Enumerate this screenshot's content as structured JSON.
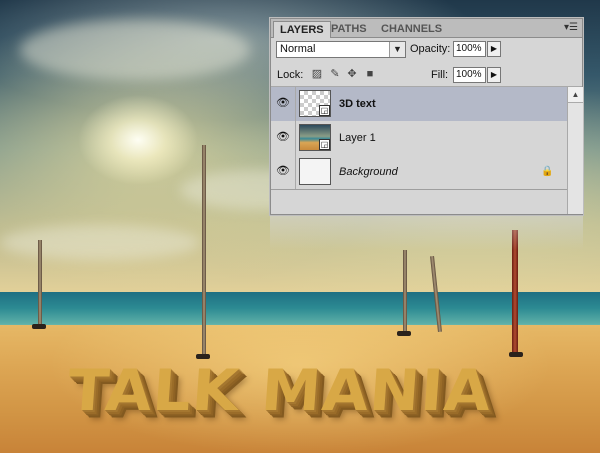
{
  "scene": {
    "headline": "TALK MANIA"
  },
  "panel": {
    "tabs": [
      {
        "label": "LAYERS",
        "active": true
      },
      {
        "label": "PATHS",
        "active": false
      },
      {
        "label": "CHANNELS",
        "active": false
      }
    ],
    "menu_icon": "panel-menu-icon",
    "blend_mode": "Normal",
    "opacity_label": "Opacity:",
    "opacity_value": "100%",
    "lock_label": "Lock:",
    "fill_label": "Fill:",
    "fill_value": "100%",
    "lock_icons": [
      "lock-transparent-icon",
      "lock-brush-icon",
      "lock-move-icon",
      "lock-all-icon"
    ],
    "layers": [
      {
        "name": "3D text",
        "selected": true,
        "thumb": "transparent",
        "smart_object": true,
        "style": "bold"
      },
      {
        "name": "Layer 1",
        "selected": false,
        "thumb": "photo",
        "smart_object": true,
        "style": "normal"
      },
      {
        "name": "Background",
        "selected": false,
        "thumb": "white",
        "smart_object": false,
        "style": "italic",
        "locked": true
      }
    ]
  },
  "colors": {
    "panel_bg": "#d6d6d6",
    "selected_layer": "#b4b9c8",
    "text_gold": "#d8a846"
  }
}
